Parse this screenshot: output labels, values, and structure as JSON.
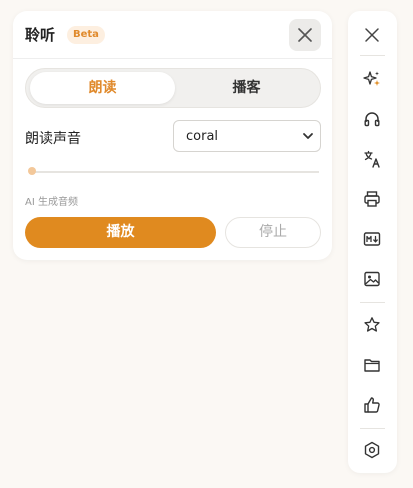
{
  "panel": {
    "title": "聆听",
    "badge": "Beta",
    "tabs": [
      {
        "label": "朗读",
        "active": true
      },
      {
        "label": "播客",
        "active": false
      }
    ],
    "voice_label": "朗读声音",
    "voice_value": "coral",
    "progress": 0,
    "ai_note": "AI 生成音频",
    "play_label": "播放",
    "stop_label": "停止"
  },
  "colors": {
    "accent": "#e08a1f",
    "accent_text": "#e08a2c",
    "background": "#fbf8f4"
  },
  "toolbar": {
    "icons": [
      "close-icon",
      "ai-sparkle-icon",
      "headphones-icon",
      "translate-icon",
      "print-icon",
      "markdown-icon",
      "image-icon",
      "star-icon",
      "folder-icon",
      "thumbs-up-icon",
      "settings-icon"
    ]
  }
}
